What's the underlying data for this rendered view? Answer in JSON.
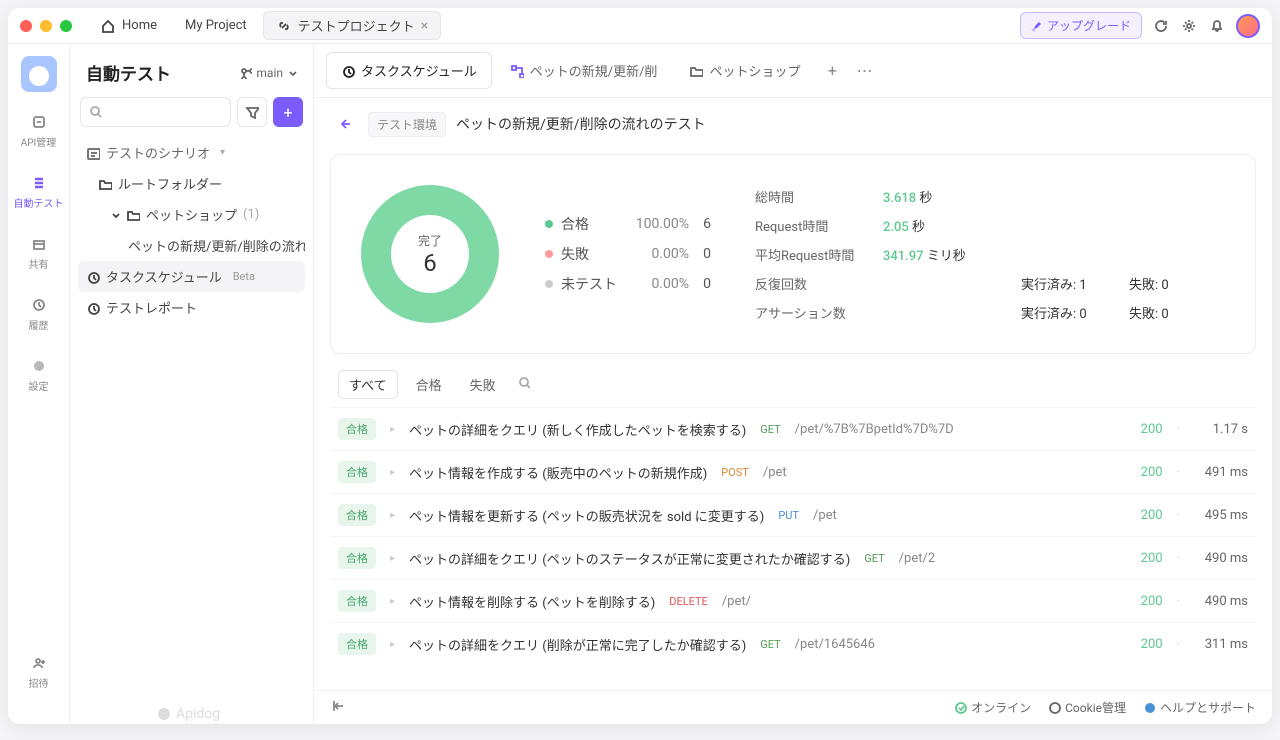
{
  "titlebar": {
    "home": "Home",
    "project": "My Project",
    "active_tab": "テストプロジェクト",
    "upgrade": "アップグレード"
  },
  "rail": {
    "items": [
      {
        "label": "API管理"
      },
      {
        "label": "自動テスト"
      },
      {
        "label": "共有"
      },
      {
        "label": "履歴"
      },
      {
        "label": "設定"
      }
    ],
    "invite": "招待"
  },
  "sidebar": {
    "title": "自動テスト",
    "branch": "main",
    "tree": {
      "scenarios": "テストのシナリオ",
      "root_folder": "ルートフォルダー",
      "petshop": "ペットショップ",
      "petshop_count": "(1)",
      "petflow": "ペットの新規/更新/削除の流れ",
      "schedule": "タスクスケジュール",
      "schedule_badge": "Beta",
      "report": "テストレポート"
    }
  },
  "content_tabs": [
    {
      "label": "タスクスケジュール",
      "icon": "clock"
    },
    {
      "label": "ペットの新規/更新/削",
      "icon": "flow"
    },
    {
      "label": "ペットショップ",
      "icon": "folder"
    }
  ],
  "breadcrumb": {
    "env": "テスト環境",
    "title": "ペットの新規/更新/削除の流れのテスト"
  },
  "summary": {
    "donut_label": "完了",
    "donut_value": "6",
    "legend": [
      {
        "name": "合格",
        "pct": "100.00%",
        "count": "6",
        "color": "green"
      },
      {
        "name": "失敗",
        "pct": "0.00%",
        "count": "0",
        "color": "red"
      },
      {
        "name": "未テスト",
        "pct": "0.00%",
        "count": "0",
        "color": "gray"
      }
    ],
    "stats": {
      "total_time_label": "総時間",
      "total_time_value": "3.618",
      "total_time_unit": "秒",
      "req_time_label": "Request時間",
      "req_time_value": "2.05",
      "req_time_unit": "秒",
      "avg_req_label": "平均Request時間",
      "avg_req_value": "341.97",
      "avg_req_unit": "ミリ秒",
      "iter_label": "反復回数",
      "iter_done": "実行済み: 1",
      "iter_fail": "失敗: 0",
      "assert_label": "アサーション数",
      "assert_done": "実行済み: 0",
      "assert_fail": "失敗: 0"
    }
  },
  "filters": {
    "all": "すべて",
    "pass": "合格",
    "fail": "失敗"
  },
  "results": [
    {
      "badge": "合格",
      "name": "ペットの詳細をクエリ (新しく作成したペットを検索する)",
      "method": "GET",
      "path": "/pet/%7B%7BpetId%7D%7D",
      "code": "200",
      "time": "1.17 s"
    },
    {
      "badge": "合格",
      "name": "ペット情報を作成する (販売中のペットの新規作成)",
      "method": "POST",
      "path": "/pet",
      "code": "200",
      "time": "491 ms"
    },
    {
      "badge": "合格",
      "name": "ペット情報を更新する (ペットの販売状況を sold に変更する)",
      "method": "PUT",
      "path": "/pet",
      "code": "200",
      "time": "495 ms"
    },
    {
      "badge": "合格",
      "name": "ペットの詳細をクエリ (ペットのステータスが正常に変更されたか確認する)",
      "method": "GET",
      "path": "/pet/2",
      "code": "200",
      "time": "490 ms"
    },
    {
      "badge": "合格",
      "name": "ペット情報を削除する (ペットを削除する)",
      "method": "DELETE",
      "path": "/pet/",
      "code": "200",
      "time": "490 ms"
    },
    {
      "badge": "合格",
      "name": "ペットの詳細をクエリ (削除が正常に完了したか確認する)",
      "method": "GET",
      "path": "/pet/1645646",
      "code": "200",
      "time": "311 ms"
    }
  ],
  "footer": {
    "online": "オンライン",
    "cookie": "Cookie管理",
    "help": "ヘルプとサポート"
  },
  "brand": "Apidog",
  "chart_data": {
    "type": "pie",
    "title": "完了",
    "series": [
      {
        "name": "合格",
        "value": 6
      },
      {
        "name": "失敗",
        "value": 0
      },
      {
        "name": "未テスト",
        "value": 0
      }
    ]
  }
}
